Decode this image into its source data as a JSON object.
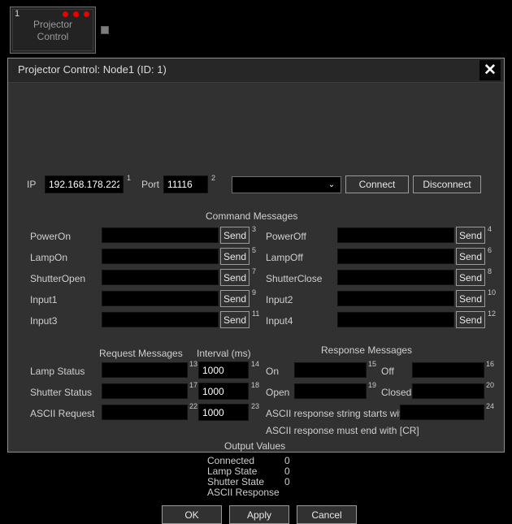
{
  "node": {
    "number": "1",
    "title_line1": "Projector",
    "title_line2": "Control",
    "led_count": 3
  },
  "dialog": {
    "title": "Projector Control: Node1 (ID: 1)",
    "close_label": "✕"
  },
  "connection": {
    "ip_label": "IP",
    "ip_value": "192.168.178.222",
    "ip_index": "1",
    "port_label": "Port",
    "port_value": "11116",
    "port_index": "2",
    "dropdown_value": "",
    "dropdown_arrow": "⌄",
    "connect_label": "Connect",
    "disconnect_label": "Disconnect"
  },
  "command_messages": {
    "section_title": "Command Messages",
    "send_label": "Send",
    "left_rows": [
      {
        "label": "PowerOn",
        "value": "",
        "index": "3"
      },
      {
        "label": "LampOn",
        "value": "",
        "index": "5"
      },
      {
        "label": "ShutterOpen",
        "value": "",
        "index": "7"
      },
      {
        "label": "Input1",
        "value": "",
        "index": "9"
      },
      {
        "label": "Input3",
        "value": "",
        "index": "11"
      }
    ],
    "right_rows": [
      {
        "label": "PowerOff",
        "value": "",
        "index": "4"
      },
      {
        "label": "LampOff",
        "value": "",
        "index": "6"
      },
      {
        "label": "ShutterClose",
        "value": "",
        "index": "8"
      },
      {
        "label": "Input2",
        "value": "",
        "index": "10"
      },
      {
        "label": "Input4",
        "value": "",
        "index": "12"
      }
    ]
  },
  "request_messages": {
    "section_title": "Request Messages",
    "interval_title": "Interval (ms)",
    "rows": [
      {
        "label": "Lamp Status",
        "request_value": "",
        "request_index": "13",
        "interval_value": "1000",
        "interval_index": "14"
      },
      {
        "label": "Shutter Status",
        "request_value": "",
        "request_index": "17",
        "interval_value": "1000",
        "interval_index": "18"
      },
      {
        "label": "ASCII Request",
        "request_value": "",
        "request_index": "22",
        "interval_value": "1000",
        "interval_index": "23"
      }
    ]
  },
  "response_messages": {
    "section_title": "Response Messages",
    "pairs": [
      {
        "left_label": "On",
        "left_value": "",
        "left_index": "15",
        "right_label": "Off",
        "right_value": "",
        "right_index": "16"
      },
      {
        "left_label": "Open",
        "left_value": "",
        "left_index": "19",
        "right_label": "Closed",
        "right_value": "",
        "right_index": "20"
      }
    ],
    "ascii_starts_label": "ASCII response string starts with:",
    "ascii_starts_value": "",
    "ascii_starts_index": "24",
    "ascii_end_note": "ASCII response must end with [CR]"
  },
  "output_values": {
    "section_title": "Output Values",
    "rows": [
      {
        "label": "Connected",
        "value": "0"
      },
      {
        "label": "Lamp State",
        "value": "0"
      },
      {
        "label": "Shutter State",
        "value": "0"
      },
      {
        "label": "ASCII Response",
        "value": ""
      }
    ]
  },
  "footer": {
    "ok_label": "OK",
    "apply_label": "Apply",
    "cancel_label": "Cancel"
  }
}
